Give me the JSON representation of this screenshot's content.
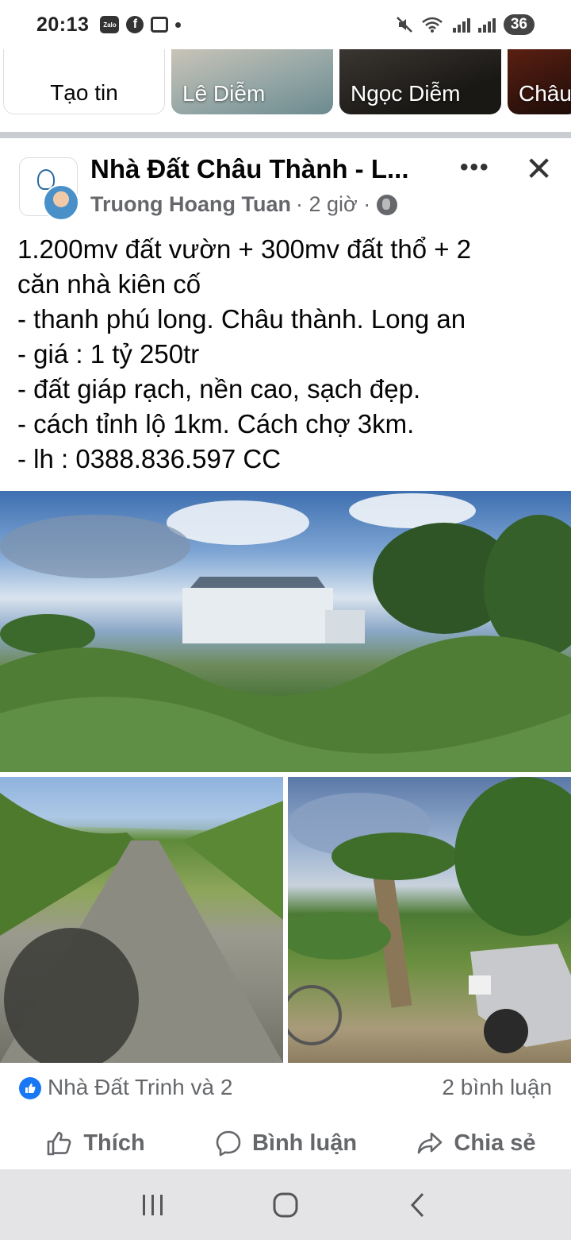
{
  "status_bar": {
    "time": "20:13",
    "zalo_label": "Zalo",
    "fb_label": "f",
    "battery": "36"
  },
  "stories": [
    {
      "label": "Tạo tin"
    },
    {
      "label": "Lê Diễm"
    },
    {
      "label": "Ngọc Diễm"
    },
    {
      "label": "Châu"
    }
  ],
  "post": {
    "group_name": "Nhà Đất Châu Thành - L...",
    "author": "Truong Hoang Tuan",
    "time": "· 2 giờ ·",
    "more_label": "•••",
    "close_label": "✕",
    "lines": [
      "1.200mv đất vườn + 300mv đất thổ + 2",
      "căn nhà kiên cố",
      "- thanh phú long. Châu thành. Long an",
      "- giá : 1 tỷ 250tr",
      "- đất giáp rạch, nền cao, sạch đẹp.",
      "- cách tỉnh lộ 1km. Cách chợ 3km.",
      "- lh : 0388.836.597 CC"
    ],
    "reaction_text": "Nhà Đất Trinh và 2",
    "comment_count": "2 bình luận"
  },
  "actions": {
    "like": "Thích",
    "comment": "Bình luận",
    "share": "Chia sẻ"
  },
  "colors": {
    "accent": "#1877f2",
    "secondary_text": "#65676b",
    "divider": "#c9ccd1",
    "nav_bar": "#e4e4e6"
  }
}
